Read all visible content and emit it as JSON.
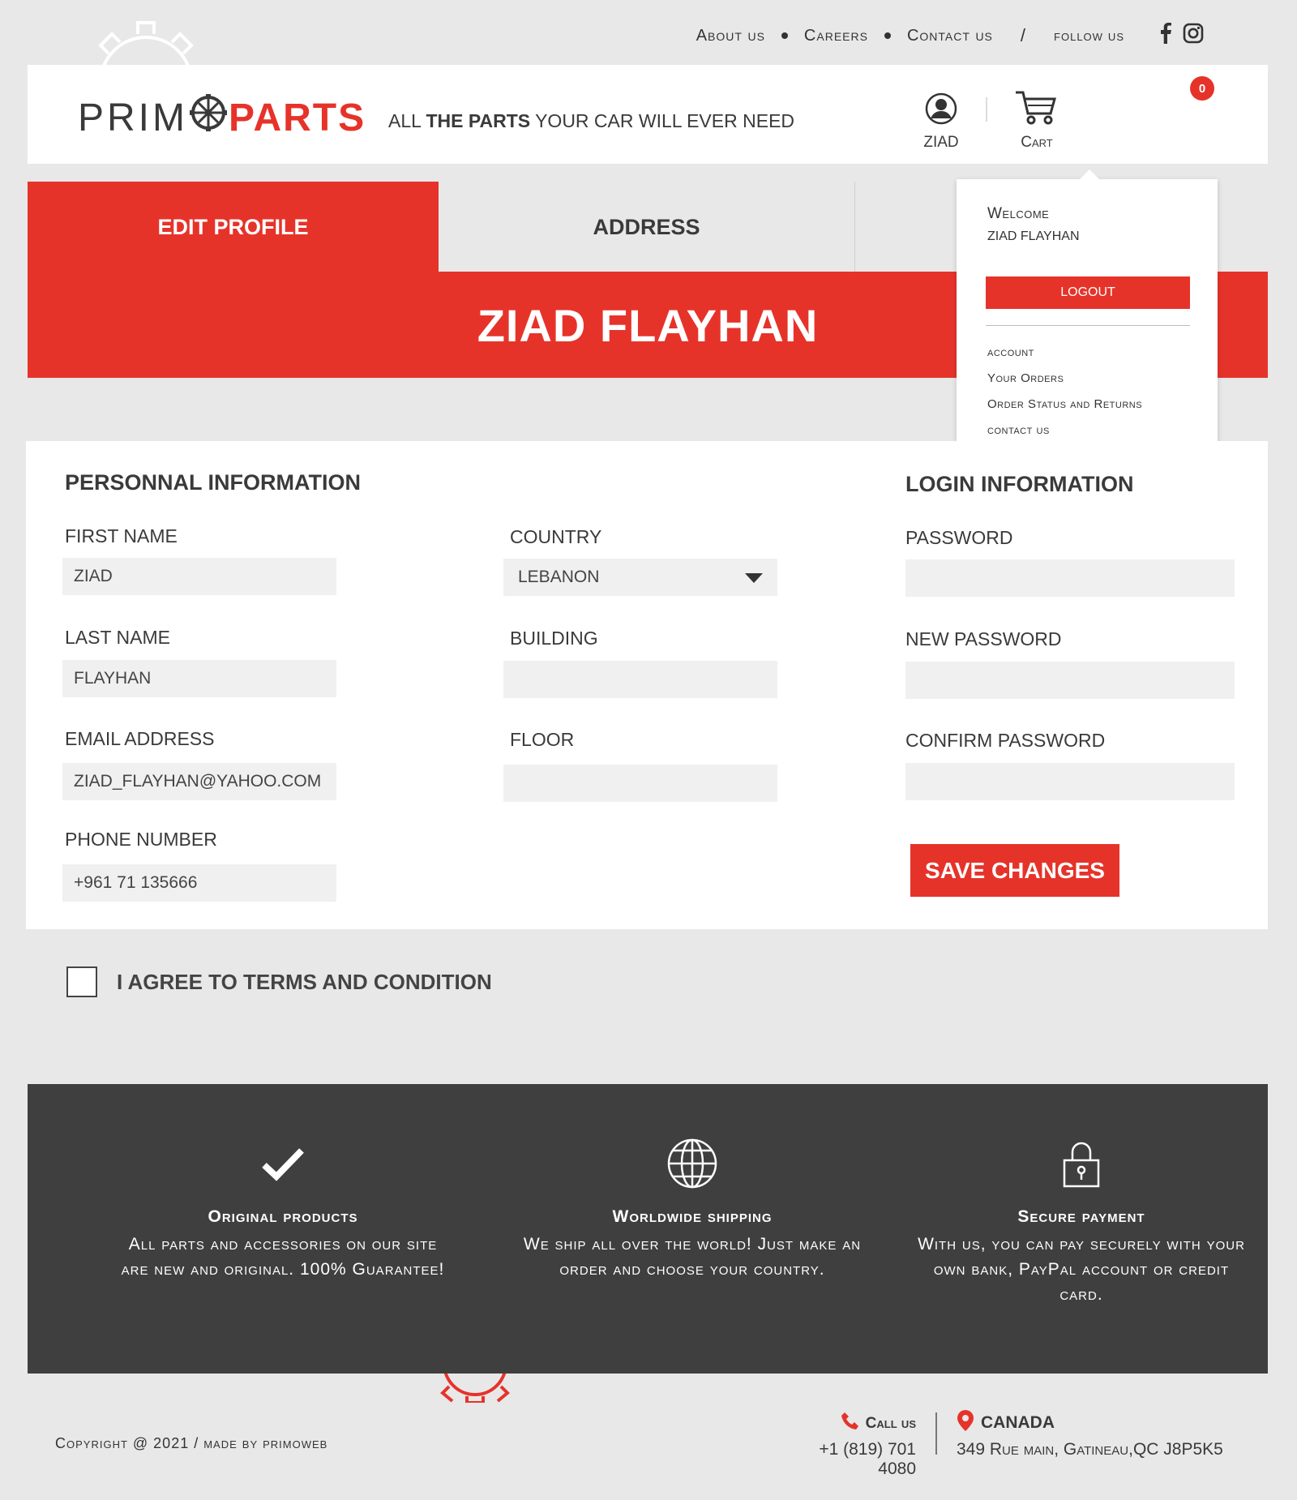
{
  "top_nav": {
    "about": "About us",
    "careers": "Careers",
    "contact": "Contact us",
    "separator": "/",
    "follow": "follow us",
    "social": [
      "facebook-icon",
      "instagram-icon"
    ]
  },
  "header": {
    "logo_primo": "PRIM",
    "logo_parts": "PARTS",
    "tagline_pre": "ALL ",
    "tagline_bold1": "THE PARTS",
    "tagline_post": " YOUR CAR  WILL EVER NEED",
    "user_label": "ZIAD",
    "cart_label": "Cart",
    "cart_count": "0"
  },
  "tabs": {
    "edit_profile": "EDIT PROFILE",
    "address": "ADDRESS"
  },
  "banner": {
    "name": "ZIAD FLAYHAN"
  },
  "dropdown": {
    "welcome": "Welcome",
    "name": "ZIAD FLAYHAN",
    "logout": "LOGOUT",
    "items": [
      "account",
      "Your Orders",
      "Order Status and Returns",
      "contact us"
    ]
  },
  "personal": {
    "title": "PERSONNAL INFORMATION",
    "first_name_label": "FIRST NAME",
    "first_name_value": "ZIAD",
    "last_name_label": "LAST NAME",
    "last_name_value": "FLAYHAN",
    "email_label": "EMAIL ADDRESS",
    "email_value": "ZIAD_FLAYHAN@YAHOO.COM",
    "phone_label": "PHONE NUMBER",
    "phone_value": "+961 71 135666"
  },
  "location": {
    "country_label": "COUNTRY",
    "country_value": "LEBANON",
    "building_label": "BUILDING",
    "building_value": "",
    "floor_label": "FLOOR",
    "floor_value": ""
  },
  "login": {
    "title": "LOGIN INFORMATION",
    "password_label": "PASSWORD",
    "new_password_label": "NEW PASSWORD",
    "confirm_password_label": "CONFIRM PASSWORD",
    "save_label": "SAVE CHANGES"
  },
  "terms": {
    "label": "I AGREE TO TERMS AND CONDITION"
  },
  "features": [
    {
      "icon": "checkmark-icon",
      "title": "Original products",
      "desc": "All parts and accessories on our site are new and original. 100% Guarantee!"
    },
    {
      "icon": "globe-icon",
      "title": "Worldwide shipping",
      "desc": "We ship all over the world! Just make an order and choose your country."
    },
    {
      "icon": "lock-icon",
      "title": "Secure payment",
      "desc": "With us, you can pay securely with your own bank, PayPal account or credit card."
    }
  ],
  "footer": {
    "copyright": "Copyright @ 2021 /  made by primoweb",
    "call_label": "Call us",
    "call_value": "+1 (819) 701 4080",
    "location_label": "CANADA",
    "location_value": "349 Rue main, Gatineau,QC J8P5K5"
  },
  "colors": {
    "accent": "#e6332a",
    "dark": "#3f3f3f",
    "background": "#e8e8e8"
  }
}
